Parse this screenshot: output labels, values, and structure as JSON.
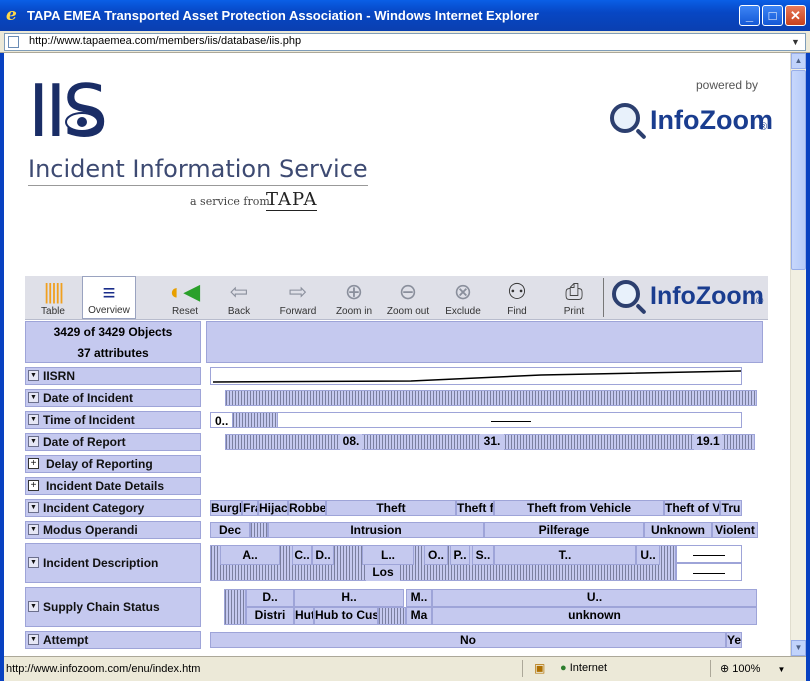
{
  "window": {
    "title": "TAPA EMEA Transported Asset Protection Association - Windows Internet Explorer"
  },
  "address": {
    "url": "http://www.tapaemea.com/members/iis/database/iis.php"
  },
  "branding": {
    "iis_logo": "IIS",
    "iis_subtitle": "Incident Information Service",
    "service_from": "a service from",
    "tapa": "TAPA",
    "powered_by": "powered by",
    "infozoom": "InfoZoom"
  },
  "toolbar": {
    "items": [
      {
        "label": "Table",
        "icon": "table-view-icon"
      },
      {
        "label": "Overview",
        "icon": "overview-icon"
      },
      {
        "label": "Reset",
        "icon": "reset-icon"
      },
      {
        "label": "Back",
        "icon": "back-arrow-icon"
      },
      {
        "label": "Forward",
        "icon": "forward-arrow-icon"
      },
      {
        "label": "Zoom in",
        "icon": "zoom-in-icon"
      },
      {
        "label": "Zoom out",
        "icon": "zoom-out-icon"
      },
      {
        "label": "Exclude",
        "icon": "exclude-icon"
      },
      {
        "label": "Find",
        "icon": "binoculars-icon"
      },
      {
        "label": "Print",
        "icon": "printer-icon"
      }
    ]
  },
  "header": {
    "objects": "3429 of 3429 Objects",
    "attributes": "37 attributes"
  },
  "attributes": [
    {
      "label": "IISRN",
      "kind": "expanded"
    },
    {
      "label": "Date of Incident",
      "kind": "expanded"
    },
    {
      "label": "Time of Incident",
      "kind": "expanded"
    },
    {
      "label": "Date of Report",
      "kind": "expanded"
    },
    {
      "label": "Delay of Reporting",
      "kind": "collapsed"
    },
    {
      "label": "Incident Date Details",
      "kind": "collapsed"
    },
    {
      "label": "Incident Category",
      "kind": "expanded"
    },
    {
      "label": "Modus Operandi",
      "kind": "expanded"
    },
    {
      "label": "Incident Description",
      "kind": "expanded"
    },
    {
      "label": "Supply Chain Status",
      "kind": "expanded"
    },
    {
      "label": "Attempt",
      "kind": "expanded"
    }
  ],
  "values": {
    "time_of_incident": "0..",
    "date_of_report": [
      "08.",
      "31.",
      "19.1"
    ],
    "incident_category": [
      "Burgl",
      "Fra",
      "Hijac",
      "Robber",
      "Theft",
      "Theft fi",
      "Theft from Vehicle",
      "Theft of V",
      "Tru"
    ],
    "modus_operandi": [
      "Dec",
      "Intrusion",
      "Pilferage",
      "Unknown",
      "Violent"
    ],
    "incident_description": [
      "A..",
      "C..",
      "D..",
      "L..",
      "O..",
      "P..",
      "S..",
      "T..",
      "U..",
      "Los"
    ],
    "supply_chain_status": [
      "D..",
      "H..",
      "M..",
      "U..",
      "Distri",
      "Hut",
      "Hub to Cust",
      "Ma",
      "unknown"
    ],
    "attempt": [
      "No",
      "Ye"
    ]
  },
  "status": {
    "text": "http://www.infozoom.com/enu/index.htm",
    "zone": "Internet",
    "zoom": "100%"
  }
}
